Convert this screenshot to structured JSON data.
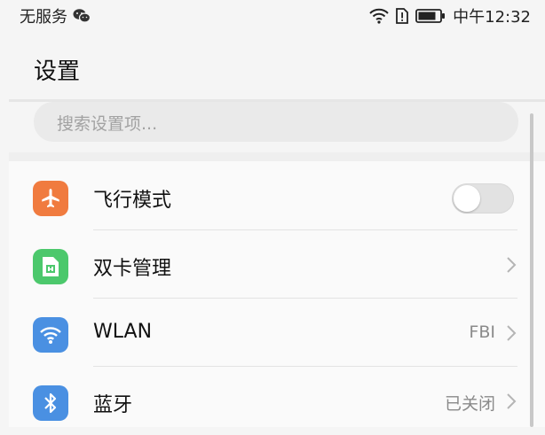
{
  "status_bar": {
    "carrier": "无服务",
    "time": "中午12:32",
    "icons": [
      "wechat-icon",
      "wifi-icon",
      "sim-alert-icon",
      "battery-icon"
    ]
  },
  "header": {
    "title": "设置"
  },
  "search": {
    "placeholder": "搜索设置项..."
  },
  "settings": [
    {
      "label": "飞行模式",
      "icon": "airplane-icon",
      "icon_color": "#f07b3f",
      "control": "toggle",
      "toggle_on": false
    },
    {
      "label": "双卡管理",
      "icon": "sim-card-icon",
      "icon_color": "#4cc86c",
      "control": "chevron"
    },
    {
      "label": "WLAN",
      "icon": "wifi-icon",
      "icon_color": "#4a90e2",
      "value": "FBI",
      "control": "chevron"
    },
    {
      "label": "蓝牙",
      "icon": "bluetooth-icon",
      "icon_color": "#4a90e2",
      "value": "已关闭",
      "control": "chevron"
    }
  ],
  "colors": {
    "background": "#f5f5f5",
    "accent_orange": "#f07b3f",
    "accent_green": "#4cc86c",
    "accent_blue": "#4a90e2"
  }
}
